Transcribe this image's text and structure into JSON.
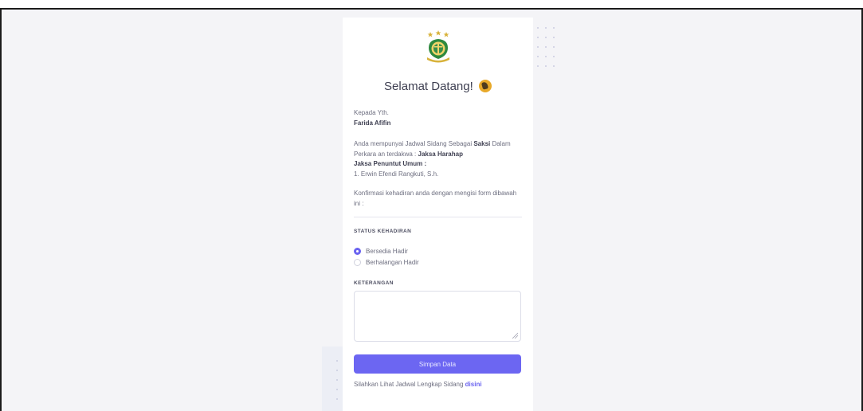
{
  "greeting": {
    "title": "Selamat Datang!",
    "emoji_icon": "waving-hand-icon"
  },
  "recipient": {
    "salutation": "Kepada Yth.",
    "name": "Farida Afifin"
  },
  "message": {
    "part1": "Anda mempunyai Jadwal Sidang Sebagai",
    "role": "Saksi",
    "part2": "Dalam Perkara an terdakwa :",
    "defendant": "Jaksa Harahap",
    "prosecutor_label": "Jaksa Penuntut Umum :",
    "prosecutor_name": "1. Erwin Efendi Rangkuti, S.h.",
    "confirm": "Konfirmasi kehadiran anda dengan mengisi form dibawah ini :"
  },
  "attendance": {
    "label": "STATUS KEHADIRAN",
    "options": [
      "Bersedia Hadir",
      "Berhalangan Hadir"
    ],
    "selected": "Bersedia Hadir"
  },
  "notes": {
    "label": "KETERANGAN",
    "value": ""
  },
  "submit": {
    "label": "Simpan Data"
  },
  "footer": {
    "text": "Silahkan Lihat Jadwal Lengkap Sidang",
    "link": "disini"
  },
  "colors": {
    "accent": "#6c66f2",
    "background": "#f4f4f7",
    "card": "#ffffff"
  }
}
